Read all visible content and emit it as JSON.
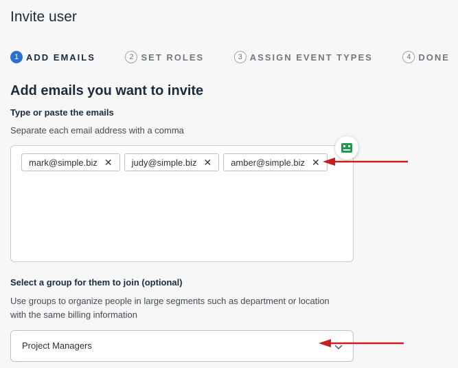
{
  "page": {
    "title": "Invite user"
  },
  "stepper": [
    {
      "num": "1",
      "label": "ADD EMAILS",
      "active": true
    },
    {
      "num": "2",
      "label": "SET ROLES",
      "active": false
    },
    {
      "num": "3",
      "label": "ASSIGN EVENT TYPES",
      "active": false
    },
    {
      "num": "4",
      "label": "DONE",
      "active": false
    }
  ],
  "section": {
    "title": "Add emails you want to invite"
  },
  "emails": {
    "label": "Type or paste the emails",
    "hint": "Separate each email address with a comma",
    "chips": [
      {
        "value": "mark@simple.biz",
        "remove": "✕"
      },
      {
        "value": "judy@simple.biz",
        "remove": "✕"
      },
      {
        "value": "amber@simple.biz",
        "remove": "✕"
      }
    ],
    "helper_icon": "robot-face-icon"
  },
  "group": {
    "label": "Select a group for them to join (optional)",
    "hint_line1": "Use groups to organize people in large segments such as department or location",
    "hint_line2": "with the same billing information",
    "selected": "Project Managers"
  },
  "colors": {
    "accent": "#2b6fd6",
    "annotation_arrow": "#c81e1e",
    "helper_icon": "#1f9a4e"
  }
}
